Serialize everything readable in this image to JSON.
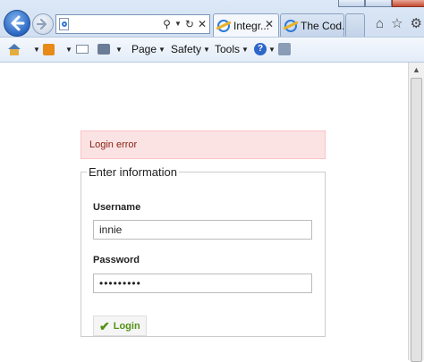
{
  "browser": {
    "tabs": [
      {
        "label": "Integr..."
      },
      {
        "label": "The Cod..."
      }
    ],
    "command_bar": {
      "page": "Page",
      "safety": "Safety",
      "tools": "Tools"
    }
  },
  "page": {
    "error_message": "Login error",
    "form": {
      "legend": "Enter information",
      "username_label": "Username",
      "username_value": "innie",
      "password_label": "Password",
      "password_value": "•••••••••",
      "login_label": "Login"
    }
  },
  "colors": {
    "error_bg": "#fbe3e4",
    "error_text": "#8a1f11",
    "button_text": "#529214"
  },
  "icons": [
    "back-icon",
    "forward-icon",
    "search-icon",
    "refresh-icon",
    "close-icon",
    "home-icon",
    "feeds-icon",
    "mail-icon",
    "print-icon",
    "help-icon",
    "research-icon",
    "star-icon",
    "gear-icon",
    "checkmark-icon"
  ]
}
